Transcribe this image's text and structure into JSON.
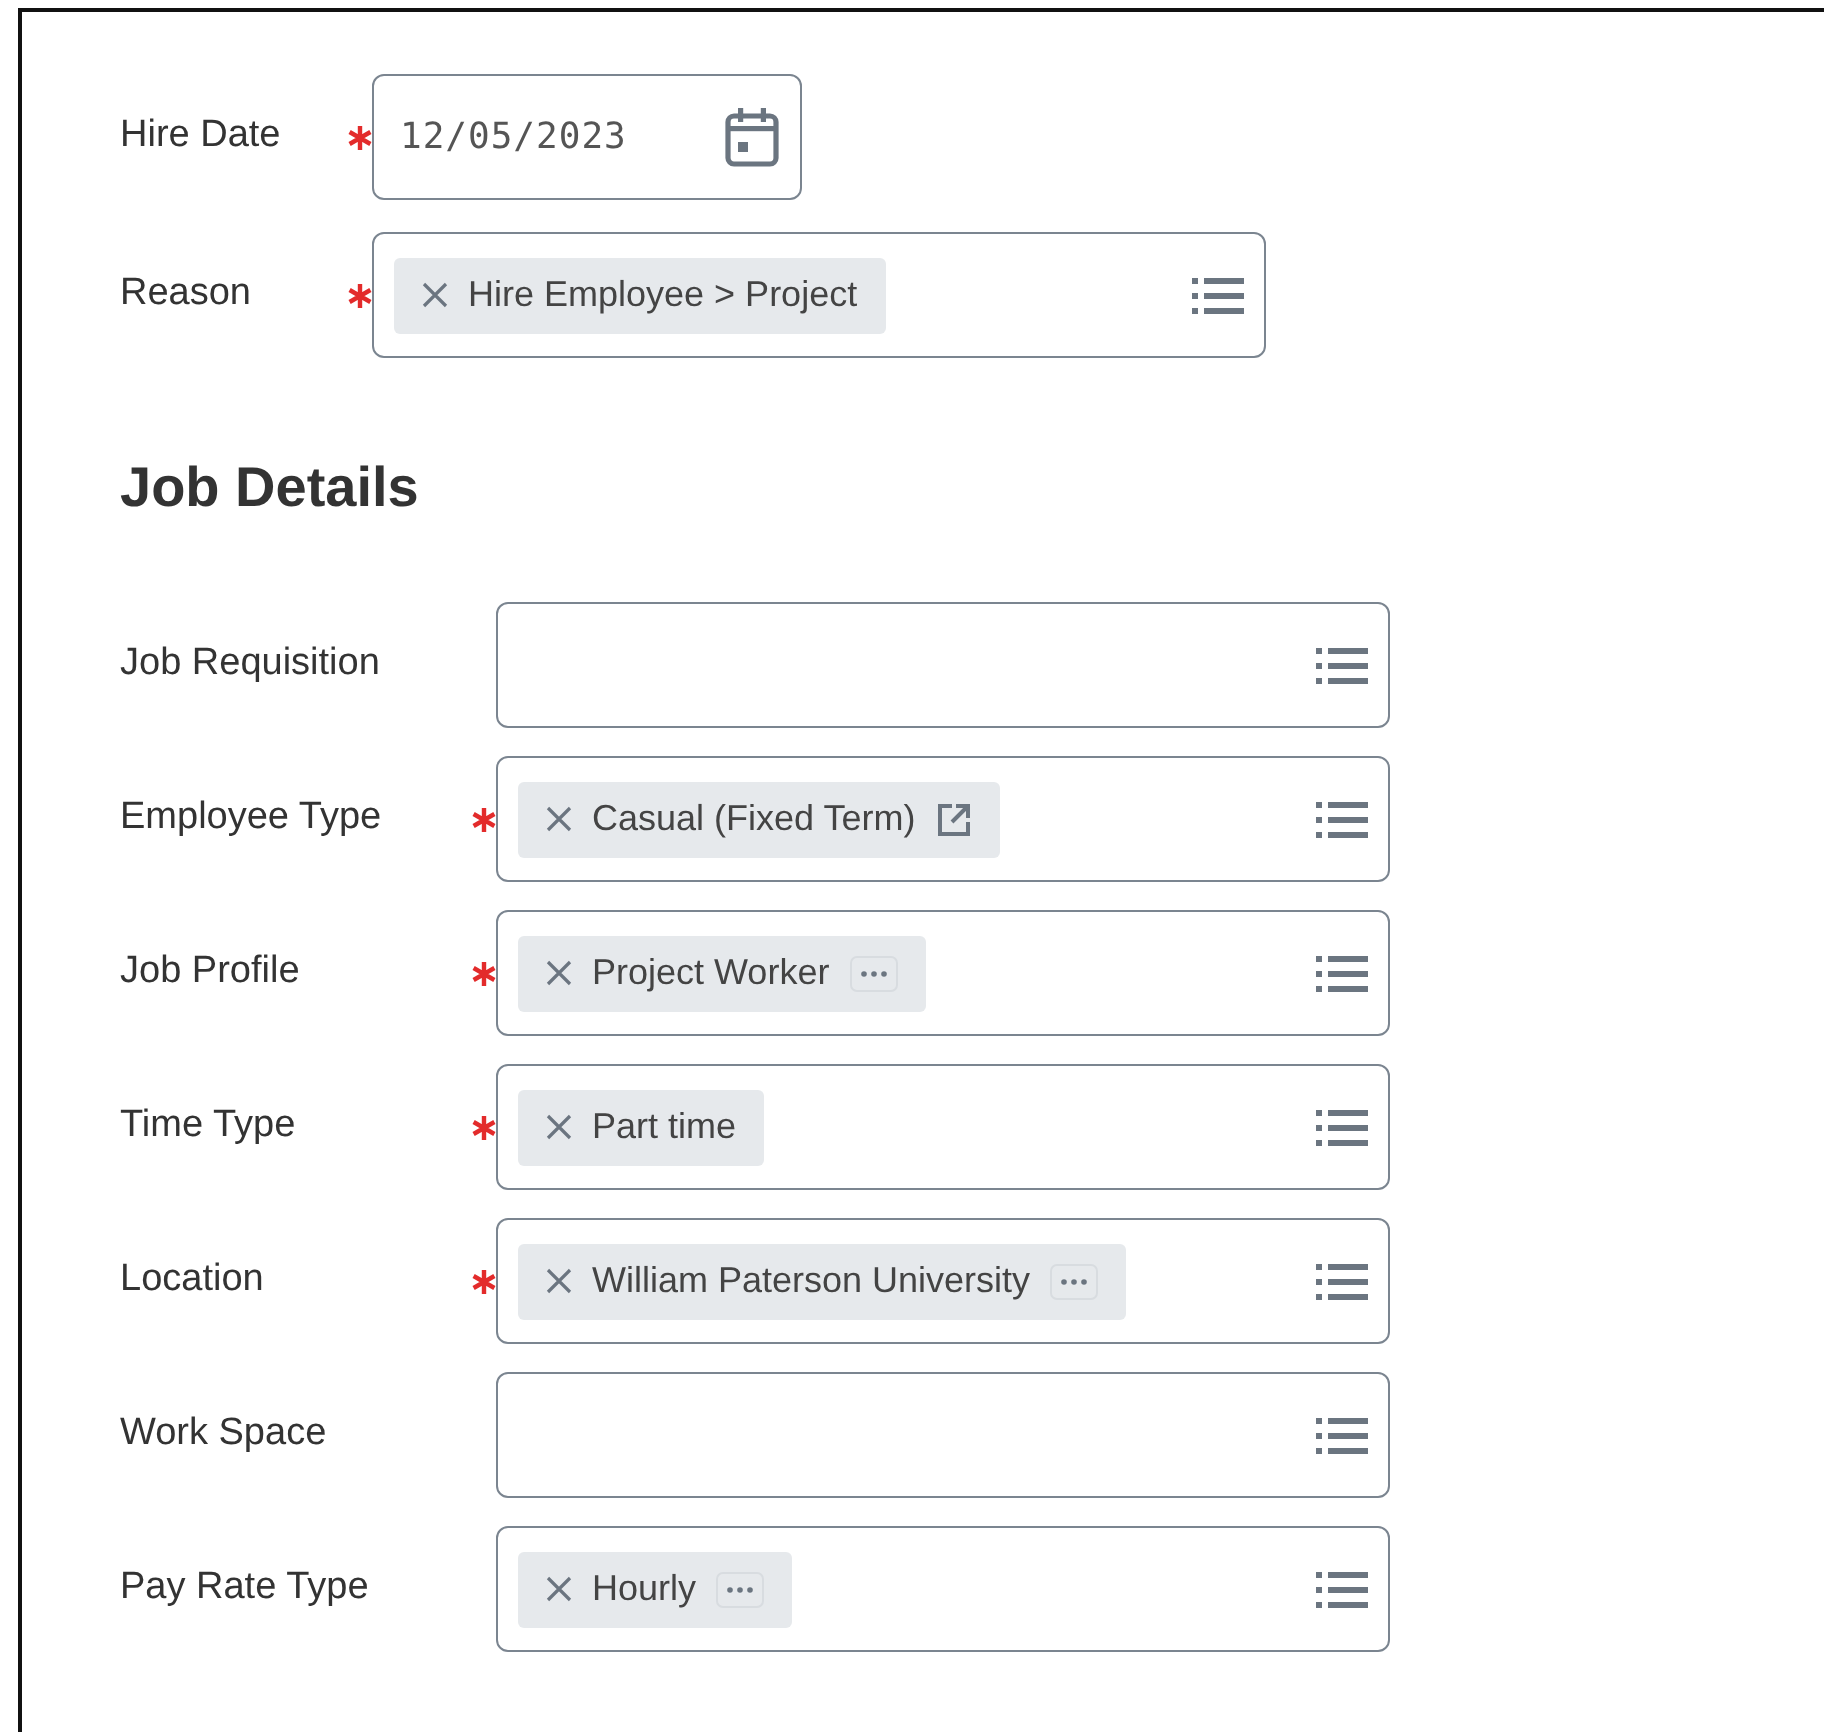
{
  "header_fields": [
    {
      "label": "Hire Date",
      "required": true,
      "kind": "date",
      "value": "12/05/2023"
    },
    {
      "label": "Reason",
      "required": true,
      "kind": "prompt",
      "chips": [
        {
          "text": "Hire Employee > Project",
          "kind": "plain"
        }
      ]
    }
  ],
  "section": {
    "title": "Job Details",
    "fields": [
      {
        "label": "Job Requisition",
        "required": false,
        "kind": "prompt"
      },
      {
        "label": "Employee Type",
        "required": true,
        "kind": "prompt",
        "chips": [
          {
            "text": "Casual (Fixed Term)",
            "kind": "link"
          }
        ]
      },
      {
        "label": "Job Profile",
        "required": true,
        "kind": "prompt",
        "chips": [
          {
            "text": "Project Worker",
            "kind": "more"
          }
        ]
      },
      {
        "label": "Time Type",
        "required": true,
        "kind": "prompt",
        "chips": [
          {
            "text": "Part time",
            "kind": "plain"
          }
        ]
      },
      {
        "label": "Location",
        "required": true,
        "kind": "prompt",
        "chips": [
          {
            "text": "William Paterson University",
            "kind": "more"
          }
        ]
      },
      {
        "label": "Work Space",
        "required": false,
        "kind": "prompt"
      },
      {
        "label": "Pay Rate Type",
        "required": false,
        "kind": "prompt",
        "chips": [
          {
            "text": "Hourly",
            "kind": "more"
          }
        ]
      }
    ]
  }
}
